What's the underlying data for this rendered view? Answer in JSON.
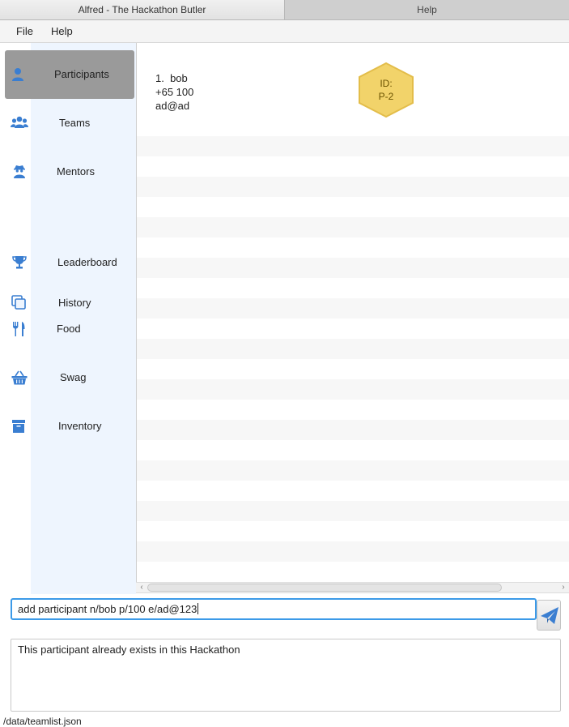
{
  "window": {
    "tabs": [
      {
        "label": "Alfred - The Hackathon Butler",
        "active": true
      },
      {
        "label": "Help",
        "active": false
      }
    ]
  },
  "menu": {
    "items": [
      "File",
      "Help"
    ]
  },
  "sidebar": {
    "selected": "Participants",
    "items": [
      {
        "label": "Participants",
        "icon": "user-icon"
      },
      {
        "label": "Teams",
        "icon": "users-icon"
      },
      {
        "label": "Mentors",
        "icon": "user-secret-icon"
      },
      {
        "label": "Leaderboard",
        "icon": "trophy-icon"
      },
      {
        "label": "History",
        "icon": "clone-icon"
      },
      {
        "label": "Food",
        "icon": "utensils-icon"
      },
      {
        "label": "Swag",
        "icon": "shopping-basket-icon"
      },
      {
        "label": "Inventory",
        "icon": "archive-icon"
      }
    ],
    "accent_color": "#3a7ed1"
  },
  "list": {
    "participants": [
      {
        "index": "1.",
        "name": "bob",
        "phone": "+65 100",
        "email": "ad@ad",
        "id_badge": {
          "line1": "ID:",
          "line2": "P-2",
          "color": "#f2d36a"
        }
      }
    ]
  },
  "command": {
    "input_value": "add participant n/bob p/100 e/ad@123",
    "send_icon": "paper-plane-icon"
  },
  "result": {
    "message": "This participant already exists in this Hackathon"
  },
  "status": {
    "path": "/data/teamlist.json"
  }
}
